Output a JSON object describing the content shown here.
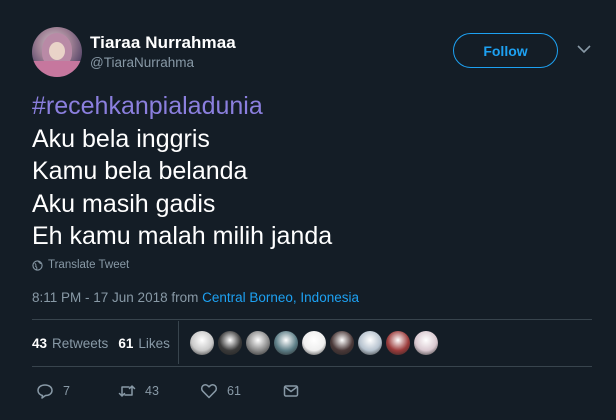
{
  "user": {
    "display_name": "Tiaraa Nurrahmaa",
    "screen_name": "@TiaraNurrahma"
  },
  "follow": {
    "label": "Follow"
  },
  "tweet": {
    "lines": [
      "#recehkanpialadunia",
      "Aku bela inggris",
      "Kamu bela belanda",
      "Aku masih gadis",
      "Eh kamu malah milih janda"
    ],
    "translate_label": "Translate Tweet",
    "time": "8:11 PM - 17 Jun 2018",
    "from_label": "from",
    "location": "Central Borneo, Indonesia"
  },
  "stats": {
    "retweets_count": "43",
    "retweets_label": "Retweets",
    "likes_count": "61",
    "likes_label": "Likes"
  },
  "liker_avatars": [
    {
      "color": "#c9c9c9"
    },
    {
      "color": "#3a3a3a"
    },
    {
      "color": "#8a8a8a"
    },
    {
      "color": "#5c7d86"
    },
    {
      "color": "#efefef"
    },
    {
      "color": "#4a3838"
    },
    {
      "color": "#b7c3cf"
    },
    {
      "color": "#9b3b3b"
    },
    {
      "color": "#d9c8d0"
    }
  ],
  "actions": {
    "reply_count": "7",
    "retweet_count": "43",
    "like_count": "61"
  },
  "colors": {
    "background": "#141d26",
    "accent": "#1da1f2",
    "hashtag": "#8b7fde",
    "muted": "#8899a6"
  },
  "icons": [
    "chevron-down-icon",
    "globe-icon",
    "reply-icon",
    "retweet-icon",
    "heart-icon",
    "message-icon"
  ]
}
